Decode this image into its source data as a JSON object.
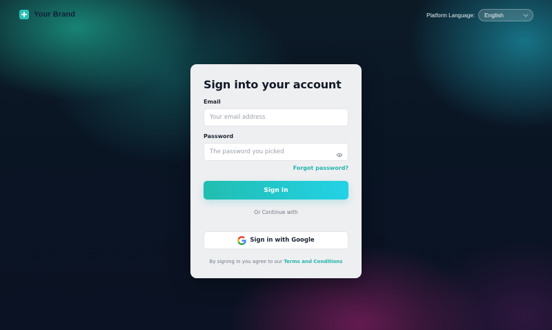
{
  "header": {
    "brand_name": "Your Brand",
    "language_label": "Platform Language:",
    "language_value": "English"
  },
  "card": {
    "title": "Sign into your account",
    "email_label": "Email",
    "email_placeholder": "Your email address",
    "password_label": "Password",
    "password_placeholder": "The password you picked",
    "forgot_password": "Forgot password?",
    "sign_in_button": "Sign In",
    "divider_text": "Or Continue with",
    "google_button": "Sign in with Google",
    "terms_prefix": "By signing in you agree to our ",
    "terms_link": "Terms and Conditions"
  },
  "icons": {
    "brand": "plus-icon",
    "language_dropdown": "chevron-down-icon",
    "password_toggle": "eye-icon",
    "google": "google-icon"
  },
  "colors": {
    "accent": "#22b3ac",
    "button_gradient_start": "#22bdb0",
    "button_gradient_end": "#23d2e6",
    "card_background": "#eeeff1"
  }
}
